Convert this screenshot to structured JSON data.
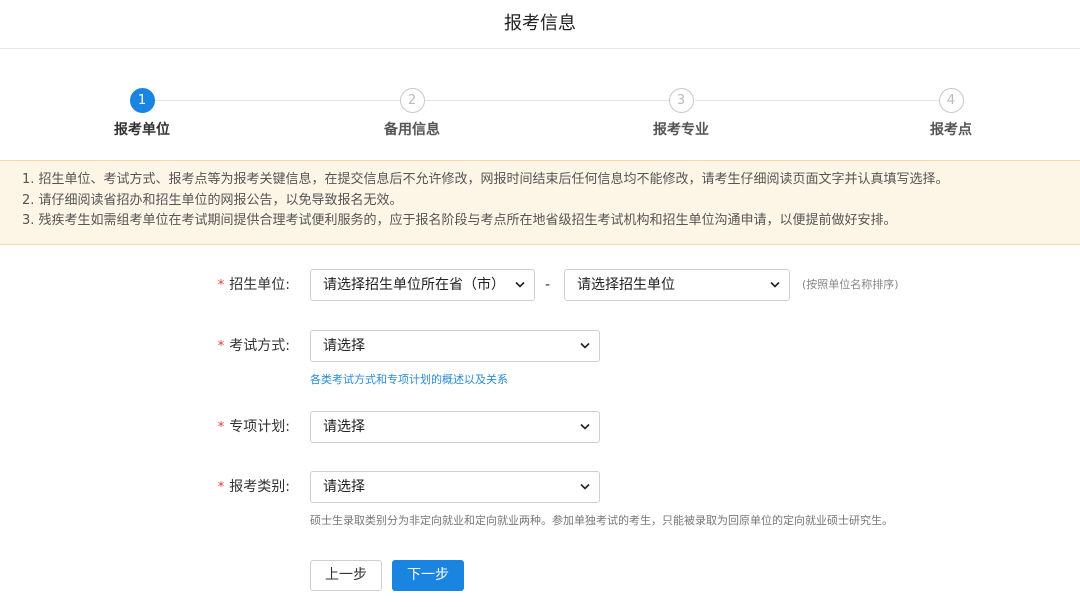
{
  "header": {
    "title": "报考信息"
  },
  "steps": [
    {
      "num": "1",
      "label": "报考单位"
    },
    {
      "num": "2",
      "label": "备用信息"
    },
    {
      "num": "3",
      "label": "报考专业"
    },
    {
      "num": "4",
      "label": "报考点"
    }
  ],
  "notice": [
    "1. 招生单位、考试方式、报考点等为报考关键信息，在提交信息后不允许修改，网报时间结束后任何信息均不能修改，请考生仔细阅读页面文字并认真填写选择。",
    "2. 请仔细阅读省招办和招生单位的网报公告，以免导致报名无效。",
    "3. 残疾考生如需组考单位在考试期间提供合理考试便利服务的，应于报名阶段与考点所在地省级招生考试机构和招生单位沟通申请，以便提前做好安排。"
  ],
  "form": {
    "unit": {
      "star": "*",
      "label": "招生单位:",
      "province_select": "请选择招生单位所在省（市）",
      "separator": "-",
      "unit_select": "请选择招生单位",
      "hint": "(按照单位名称排序)"
    },
    "exam_method": {
      "star": "*",
      "label": "考试方式:",
      "select": "请选择",
      "help_link": "各类考试方式和专项计划的概述以及关系"
    },
    "special_plan": {
      "star": "*",
      "label": "专项计划:",
      "select": "请选择"
    },
    "category": {
      "star": "*",
      "label": "报考类别:",
      "select": "请选择",
      "help": "硕士生录取类别分为非定向就业和定向就业两种。参加单独考试的考生，只能被录取为回原单位的定向就业硕士研究生。"
    }
  },
  "buttons": {
    "prev": "上一步",
    "next": "下一步"
  },
  "colors": {
    "primary": "#1a85e0",
    "required": "#e53935",
    "notice_bg": "#fdf5e6",
    "link": "#2a8bd6"
  }
}
